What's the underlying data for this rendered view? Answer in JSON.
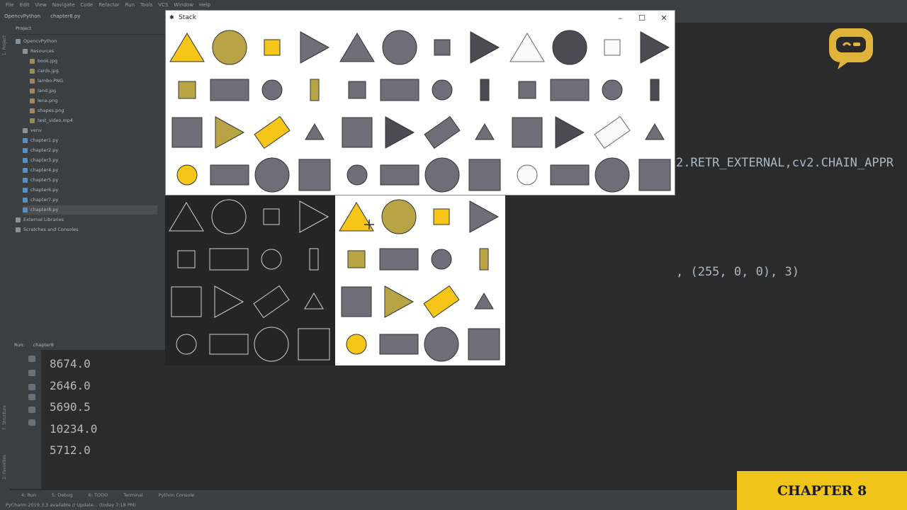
{
  "menu": [
    "File",
    "Edit",
    "View",
    "Navigate",
    "Code",
    "Refactor",
    "Run",
    "Tools",
    "VCS",
    "Window",
    "Help"
  ],
  "breadcrumbs": [
    "OpencvPython",
    "chapter8.py"
  ],
  "project": {
    "header": "Project",
    "items": [
      {
        "label": "OpencvPython",
        "kind": "folder"
      },
      {
        "label": "Resources",
        "kind": "folder"
      },
      {
        "label": "book.jpg",
        "kind": "img"
      },
      {
        "label": "cards.jpg",
        "kind": "img"
      },
      {
        "label": "lambo.PNG",
        "kind": "img"
      },
      {
        "label": "land.jpg",
        "kind": "img"
      },
      {
        "label": "lena.png",
        "kind": "img"
      },
      {
        "label": "shapes.png",
        "kind": "img"
      },
      {
        "label": "test_video.mp4",
        "kind": "img"
      },
      {
        "label": "venv",
        "kind": "folder"
      },
      {
        "label": "chapter1.py",
        "kind": "file"
      },
      {
        "label": "chapter2.py",
        "kind": "file"
      },
      {
        "label": "chapter3.py",
        "kind": "file"
      },
      {
        "label": "chapter4.py",
        "kind": "file"
      },
      {
        "label": "chapter5.py",
        "kind": "file"
      },
      {
        "label": "chapter6.py",
        "kind": "file"
      },
      {
        "label": "chapter7.py",
        "kind": "file"
      },
      {
        "label": "chapter8.py",
        "kind": "file"
      },
      {
        "label": "External Libraries",
        "kind": "folder"
      },
      {
        "label": "Scratches and Consoles",
        "kind": "folder"
      }
    ]
  },
  "editor": {
    "line1": "2.RETR_EXTERNAL,cv2.CHAIN_APPR",
    "line2": ", (255, 0, 0), 3)"
  },
  "run": {
    "tab_label": "Run:",
    "config": "chapter8",
    "output": [
      "8674.0",
      "2646.0",
      "5690.5",
      "10234.0",
      "5712.0"
    ]
  },
  "side_labels": {
    "project": "1: Project",
    "structure": "7: Structure",
    "favorites": "2: Favorites"
  },
  "status": {
    "tools": [
      "4: Run",
      "5: Debug",
      "6: TODO",
      "Terminal",
      "Python Console"
    ],
    "message": "PyCharm 2019.3.3 available // Update... (today 7:18 PM)"
  },
  "window": {
    "title": "Stack",
    "minimize": "–",
    "maximize": "☐",
    "close": "✕"
  },
  "badge": "CHAPTER 8",
  "colors": {
    "yellow": "#f5c518",
    "gray": "#6f6e78",
    "dark": "#4c4b53",
    "olive": "#b8a444",
    "ide_bg": "#2b2b2b",
    "panel": "#3c3f41"
  }
}
